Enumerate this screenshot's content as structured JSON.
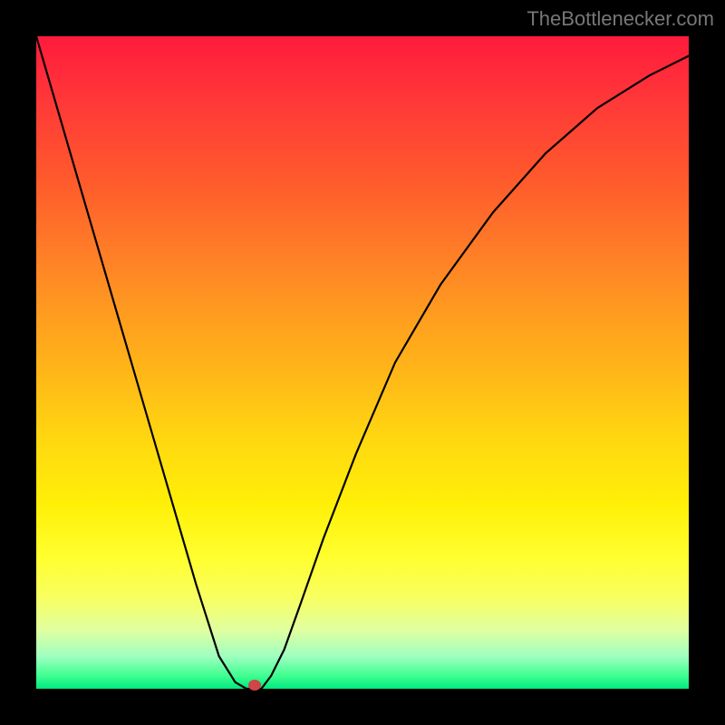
{
  "watermark": "TheBottlenecker.com",
  "chart_data": {
    "type": "line",
    "title": "",
    "xlabel": "",
    "ylabel": "",
    "xlim": [
      0,
      100
    ],
    "ylim": [
      0,
      100
    ],
    "x": [
      0,
      3.5,
      7,
      10.5,
      14,
      17.5,
      21,
      24.5,
      28,
      30.5,
      32.2,
      33.3,
      34.5,
      36,
      38,
      40.5,
      44,
      49,
      55,
      62,
      70,
      78,
      86,
      94,
      100
    ],
    "y": [
      100,
      88,
      76,
      64,
      52,
      40,
      28,
      16,
      5,
      1,
      0,
      0,
      0,
      2,
      6,
      13,
      23,
      36,
      50,
      62,
      73,
      82,
      89,
      94,
      97
    ],
    "marker": {
      "x": 33.5,
      "y": 0.5,
      "color": "#d04545"
    },
    "gradient_colors": {
      "top": "#ff1a3c",
      "bottom": "#00e880"
    }
  }
}
